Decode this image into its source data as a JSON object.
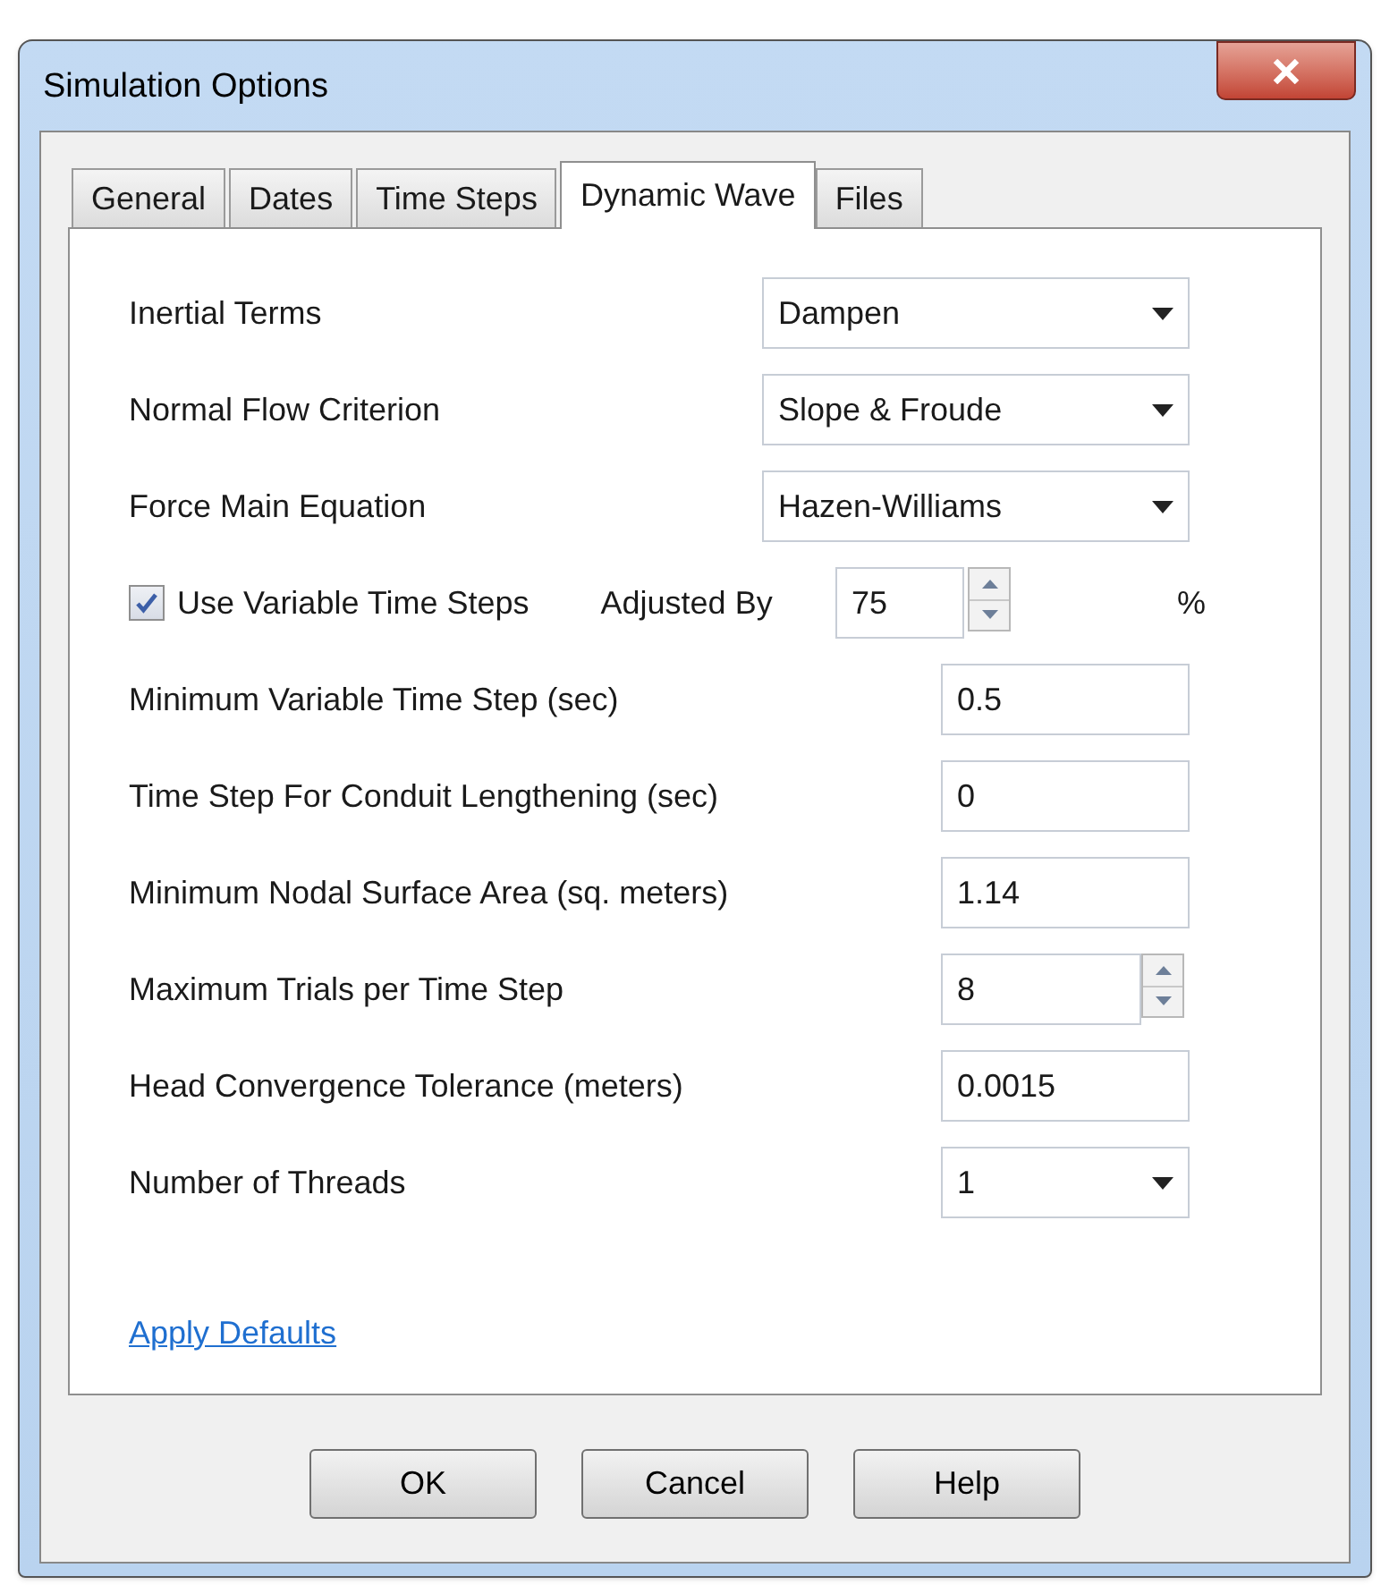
{
  "window": {
    "title": "Simulation Options"
  },
  "tabs": [
    {
      "label": "General",
      "selected": false
    },
    {
      "label": "Dates",
      "selected": false
    },
    {
      "label": "Time Steps",
      "selected": false
    },
    {
      "label": "Dynamic Wave",
      "selected": true
    },
    {
      "label": "Files",
      "selected": false
    }
  ],
  "fields": [
    {
      "kind": "dropdown",
      "label": "Inertial Terms",
      "value": "Dampen"
    },
    {
      "kind": "dropdown",
      "label": "Normal Flow Criterion",
      "value": "Slope & Froude"
    },
    {
      "kind": "dropdown",
      "label": "Force Main Equation",
      "value": "Hazen-Williams"
    },
    {
      "kind": "checkbox_spin",
      "label": "Use Variable Time Steps",
      "checked": true,
      "spin_label": "Adjusted By",
      "value": "75",
      "unit": "%"
    },
    {
      "kind": "text",
      "label": "Minimum Variable Time Step (sec)",
      "value": "0.5"
    },
    {
      "kind": "text",
      "label": "Time Step For Conduit Lengthening (sec)",
      "value": "0"
    },
    {
      "kind": "text",
      "label": "Minimum Nodal Surface Area (sq. meters)",
      "value": "1.14"
    },
    {
      "kind": "spin",
      "label": "Maximum Trials per Time Step",
      "value": "8"
    },
    {
      "kind": "text",
      "label": "Head Convergence Tolerance (meters)",
      "value": "0.0015"
    },
    {
      "kind": "small_dropdown",
      "label": "Number of Threads",
      "value": "1"
    }
  ],
  "link": "Apply Defaults",
  "buttons": [
    "OK",
    "Cancel",
    "Help"
  ]
}
